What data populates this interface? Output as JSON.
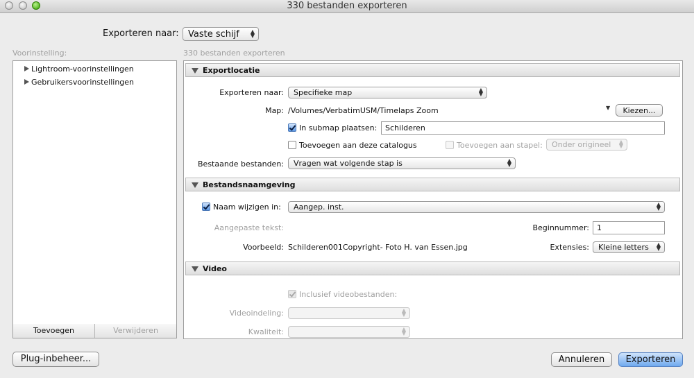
{
  "window": {
    "title": "330 bestanden exporteren"
  },
  "top": {
    "export_to_label": "Exporteren naar:",
    "export_to_value": "Vaste schijf"
  },
  "presets": {
    "label": "Voorinstelling:",
    "items": [
      {
        "label": "Lightroom-voorinstellingen"
      },
      {
        "label": "Gebruikersvoorinstellingen"
      }
    ],
    "add_button": "Toevoegen",
    "remove_button": "Verwijderen"
  },
  "main": {
    "count_label": "330 bestanden exporteren",
    "export_location": {
      "title": "Exportlocatie",
      "export_to_label": "Exporteren naar:",
      "export_to_value": "Specifieke map",
      "folder_label": "Map:",
      "folder_path": "/Volumes/VerbatimUSM/Timelaps Zoom",
      "choose_button": "Kiezen...",
      "subfolder_label": "In submap plaatsen:",
      "subfolder_checked": true,
      "subfolder_value": "Schilderen",
      "add_catalog_label": "Toevoegen aan deze catalogus",
      "add_catalog_checked": false,
      "add_stack_label": "Toevoegen aan stapel:",
      "add_stack_checked": false,
      "stack_value": "Onder origineel",
      "existing_label": "Bestaande bestanden:",
      "existing_value": "Vragen wat volgende stap is"
    },
    "file_naming": {
      "title": "Bestandsnaamgeving",
      "rename_label": "Naam wijzigen in:",
      "rename_checked": true,
      "rename_value": "Aangep. inst.",
      "custom_text_label": "Aangepaste tekst:",
      "start_number_label": "Beginnummer:",
      "start_number_value": "1",
      "example_label": "Voorbeeld:",
      "example_value": "Schilderen001Copyright- Foto H. van Essen.jpg",
      "extensions_label": "Extensies:",
      "extensions_value": "Kleine letters"
    },
    "video": {
      "title": "Video",
      "include_label": "Inclusief videobestanden:",
      "include_checked": true,
      "format_label": "Videoindeling:",
      "format_value": "",
      "quality_label": "Kwaliteit:",
      "quality_value": ""
    }
  },
  "footer": {
    "plugin_button": "Plug-inbeheer...",
    "cancel_button": "Annuleren",
    "export_button": "Exporteren"
  }
}
